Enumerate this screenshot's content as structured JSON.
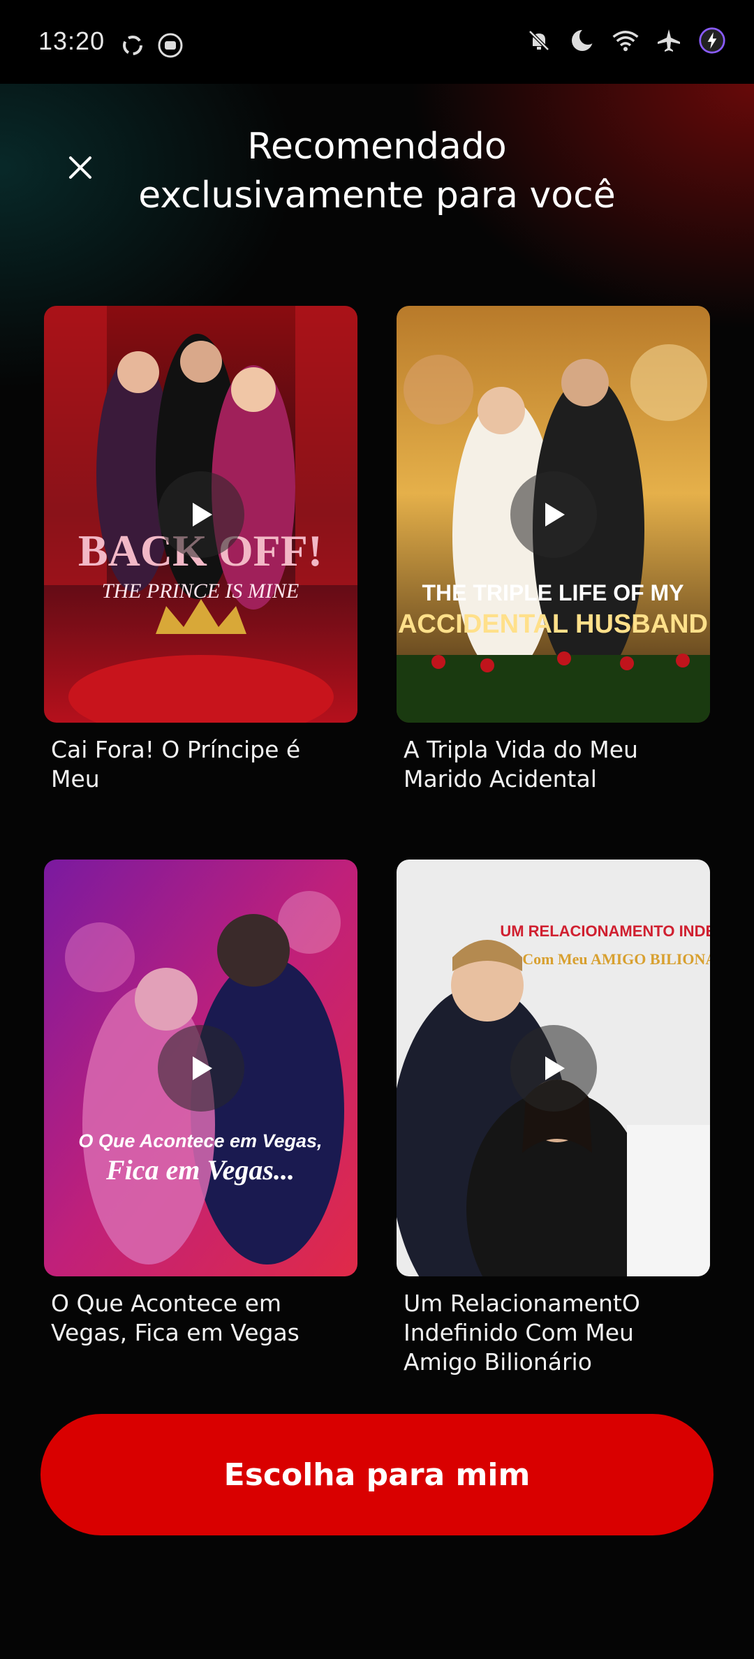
{
  "status_bar": {
    "time": "13:20",
    "left_icons": [
      "recycle-icon",
      "screen-record-icon"
    ],
    "right_icons": [
      "bell-off-icon",
      "moon-icon",
      "wifi-icon",
      "airplane-icon",
      "charging-icon"
    ]
  },
  "header": {
    "title": "Recomendado exclusivamente para você"
  },
  "cards": [
    {
      "title": "Cai Fora! O Príncipe é Meu",
      "poster_text_1": "BACK OFF!",
      "poster_text_2": "THE PRINCE IS MINE"
    },
    {
      "title": "A Tripla Vida do Meu Marido Acidental",
      "poster_text_1": "THE TRIPLE LIFE OF MY",
      "poster_text_2": "ACCIDENTAL HUSBAND"
    },
    {
      "title": "O Que Acontece em Vegas, Fica em Vegas",
      "poster_text_1": "O Que Acontece em Vegas,",
      "poster_text_2": "Fica em Vegas..."
    },
    {
      "title": "Um RelacionamentO Indefinido Com Meu Amigo Bilionário",
      "poster_text_1": "UM RELACIONAMENTO INDEFINIDO",
      "poster_text_2": "Com Meu AMIGO BILIONÁRIO"
    }
  ],
  "cta": {
    "label": "Escolha para mim"
  },
  "colors": {
    "accent": "#d90000",
    "background": "#050505"
  }
}
